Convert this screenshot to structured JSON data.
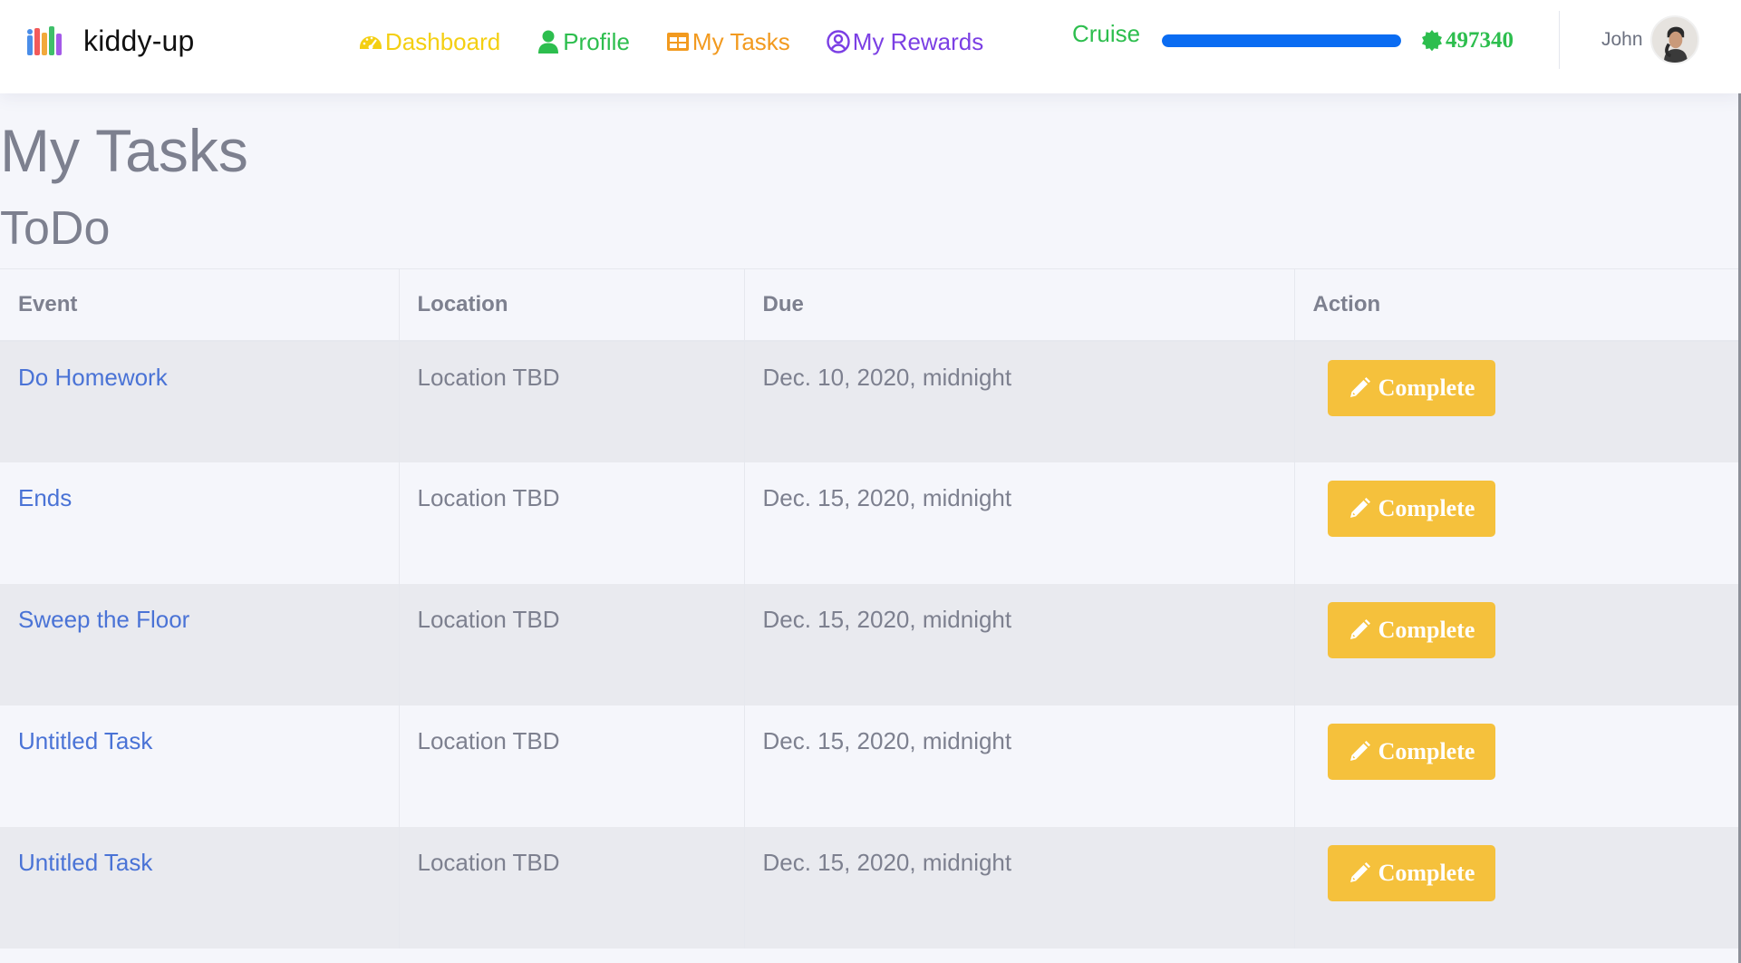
{
  "app": {
    "brand": "kiddy-up"
  },
  "nav": {
    "items": [
      {
        "label": "Dashboard",
        "color": "#f4cf12",
        "icon": "speedometer-icon"
      },
      {
        "label": "Profile",
        "color": "#2dbe4e",
        "icon": "user-icon"
      },
      {
        "label": "My Tasks",
        "color": "#f29a1f",
        "icon": "table-icon"
      },
      {
        "label": "My Rewards",
        "color": "#7b3fe4",
        "icon": "user-circle-icon"
      }
    ]
  },
  "status": {
    "level": "Cruise",
    "progress": 1.0,
    "progress_color": "#0a6cf2",
    "points": "497340",
    "points_color": "#2dbe4e"
  },
  "user": {
    "name": "John"
  },
  "page": {
    "title": "My Tasks",
    "section": "ToDo"
  },
  "table": {
    "columns": [
      "Event",
      "Location",
      "Due",
      "Action"
    ],
    "rows": [
      {
        "event": "Do Homework",
        "location": "Location TBD",
        "due": "Dec. 10, 2020, midnight",
        "action": "Complete"
      },
      {
        "event": "Ends",
        "location": "Location TBD",
        "due": "Dec. 15, 2020, midnight",
        "action": "Complete"
      },
      {
        "event": "Sweep the Floor",
        "location": "Location TBD",
        "due": "Dec. 15, 2020, midnight",
        "action": "Complete"
      },
      {
        "event": "Untitled Task",
        "location": "Location TBD",
        "due": "Dec. 15, 2020, midnight",
        "action": "Complete"
      },
      {
        "event": "Untitled Task",
        "location": "Location TBD",
        "due": "Dec. 15, 2020, midnight",
        "action": "Complete"
      }
    ]
  },
  "colors": {
    "accent_button": "#f5c13c",
    "link": "#4a73d6"
  }
}
